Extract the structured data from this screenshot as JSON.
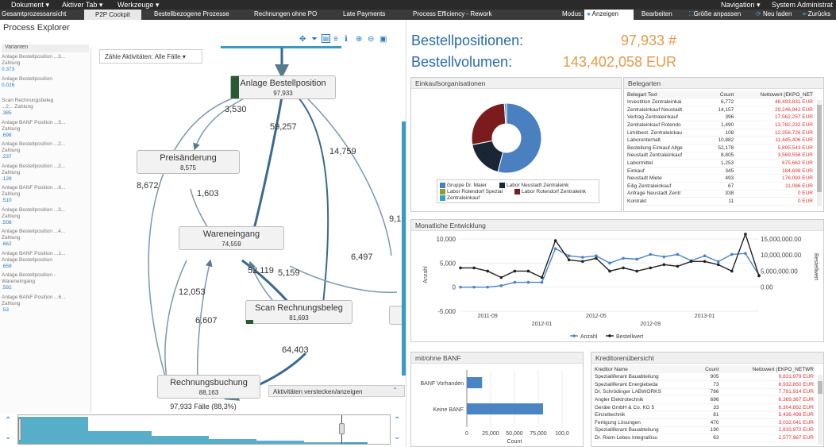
{
  "menu": {
    "dokument": "Dokument ▾",
    "aktiver_tab": "Aktiver Tab ▾",
    "werkzeuge": "Werkzeuge ▾",
    "navigation": "Navigation ▾",
    "user": "System Administrat"
  },
  "tabs": [
    "Gesamtprozessansicht",
    "P2P Cockpit",
    "Bestellbezogene Prozesse",
    "Rechnungen ohne PO",
    "Late Payments",
    "Process Efficiency - Rework"
  ],
  "toolbar": {
    "modus": "Modus:",
    "anzeigen": "Anzeigen",
    "bearbeiten": "Bearbeiten",
    "groesse": "Größe anpassen",
    "neu_laden": "Neu laden",
    "zurueck": "Zurücks"
  },
  "process_explorer": {
    "title": "Process Explorer",
    "variants_header": "Varianten",
    "variants": [
      {
        "name": "Anlage Bestellposition ...3...",
        "sub": "Zahlung",
        "val": "0.373"
      },
      {
        "name": "Anlage Bestellposition",
        "sub": "",
        "val": "0.026"
      },
      {
        "name": "Scan Rechnungsbeleg",
        "sub": "...2... Zahlung",
        "val": ".385"
      },
      {
        "name": "Anlage BANF Position ...5...",
        "sub": "Zahlung",
        "val": ".698"
      },
      {
        "name": "Anlage Bestellposition ...2...",
        "sub": "Zahlung",
        "val": ".237"
      },
      {
        "name": "Anlage Bestellposition ...2...",
        "sub": "Zahlung",
        "val": ".128"
      },
      {
        "name": "Anlage BANF Position ...6...",
        "sub": "Zahlung",
        "val": ".510"
      },
      {
        "name": "Anlage Bestellposition ...3...",
        "sub": "Zahlung",
        "val": ".508"
      },
      {
        "name": "Anlage Bestellposition ...4...",
        "sub": "Zahlung",
        "val": ".662"
      },
      {
        "name": "Anlage BANF Position ...1...",
        "sub": "Anlage Bestellposition",
        "val": ".659"
      },
      {
        "name": "Anlage Bestellposition -",
        "sub": "Wareneingang",
        "val": ".592"
      },
      {
        "name": "Anlage BANF Position ...6...",
        "sub": "Zahlung",
        "val": ".53"
      }
    ],
    "count_dropdown": "Zähle Aktivitäten: Alle Fälle ▾",
    "nodes": [
      {
        "id": "anlage",
        "label": "Anlage Bestellposition",
        "count": "97,933"
      },
      {
        "id": "preis",
        "label": "Preisänderung",
        "count": "8,575"
      },
      {
        "id": "wareneingang",
        "label": "Wareneingang",
        "count": "74,559"
      },
      {
        "id": "scan",
        "label": "Scan Rechnungsbeleg",
        "count": "81,693"
      },
      {
        "id": "rechnung",
        "label": "Rechnungsbuchung",
        "count": "88,163"
      }
    ],
    "edges": [
      "3,530",
      "59,257",
      "14,759",
      "8,672",
      "1,603",
      "9,1",
      "52,119",
      "5,159",
      "6,497",
      "12,053",
      "6,607",
      "64,403"
    ],
    "hide_label": "Aktivitäten verstecken/anzeigen",
    "case_count": "97,933 Fälle (88,3%)"
  },
  "kpis": [
    {
      "label": "Bestellpositionen:",
      "value": "97,933 #"
    },
    {
      "label": "Bestellvolumen:",
      "value": "143,402,058 EUR"
    }
  ],
  "einkauf": {
    "title": "Einkaufsorganisationen",
    "legend": [
      {
        "name": "Gruppe Dr. Maier",
        "color": "#4a7fc0"
      },
      {
        "name": "Labor Neustadt Zentraleink",
        "color": "#1a2636"
      },
      {
        "name": "Labor Rotendorf Spezial",
        "color": "#8aa030"
      },
      {
        "name": "Labor Rotendorf Zentraleink",
        "color": "#7a1c1e"
      },
      {
        "name": "Zentraleinkauf",
        "color": "#3aa0c0"
      }
    ],
    "slices": [
      {
        "name": "Gruppe Dr. Maier",
        "value": 54,
        "color": "#4a7fc0"
      },
      {
        "name": "Labor Neustadt Zentraleink",
        "value": 18,
        "color": "#1a2636"
      },
      {
        "name": "Labor Rotendorf Zentraleink",
        "value": 27,
        "color": "#7a1c1e"
      },
      {
        "name": "Zentraleinkauf",
        "value": 1,
        "color": "#3aa0c0"
      }
    ]
  },
  "belegarten": {
    "title": "Belegarten",
    "columns": [
      "Belegart Text",
      "Count",
      "Nettowert (EKPO_NET"
    ],
    "rows": [
      [
        "Investition Zentraleinkai",
        "6,772",
        "48,493,831 EUR"
      ],
      [
        "Zentraleinkauf Neustadt",
        "14,157",
        "29,246,942 EUR"
      ],
      [
        "Vertrag Zentraleinkauf",
        "396",
        "17,562,257 EUR"
      ],
      [
        "Zentraleinkauf Rotendo",
        "1,490",
        "13,782,232 EUR"
      ],
      [
        "Limitbest. Zentraleinkau",
        "108",
        "12,356,726 EUR"
      ],
      [
        "Laborunterhalt",
        "10,882",
        "11,445,406 EUR"
      ],
      [
        "Bestellung Einkauf Allge",
        "52,178",
        "5,895,543 EUR"
      ],
      [
        "Neustadt Zentraleinkauf",
        "8,805",
        "3,569,556 EUR"
      ],
      [
        "Labormittel",
        "1,253",
        "675,662 EUR"
      ],
      [
        "Einkauf",
        "345",
        "184,698 EUR"
      ],
      [
        "Neustadt Miete",
        "493",
        "176,093 EUR"
      ],
      [
        "Eilig Zentraleinkauf",
        "67",
        "11,086 EUR"
      ],
      [
        "Anfrage Neustadt Zentr",
        "338",
        "0 EUR"
      ],
      [
        "Kontrakt",
        "11",
        "0 EUR"
      ]
    ]
  },
  "monatlich": {
    "title": "Monatliche Entwicklung",
    "ylabel_left": "Anzahl",
    "ylabel_right": "Bestellwert",
    "left_ticks": [
      "10,000",
      "5,000",
      "0",
      "-5,000"
    ],
    "right_ticks": [
      "15,000,000.00",
      "10,000,000.00",
      "5,000,000.00",
      "0.00"
    ],
    "x_ticks_top": [
      "2011-09",
      "2012-05",
      "2013-01"
    ],
    "x_ticks_bottom": [
      "2012-01",
      "2012-09"
    ],
    "legend": [
      "Anzahl",
      "Bestellwert"
    ]
  },
  "chart_data": [
    {
      "type": "line",
      "title": "Monatliche Entwicklung",
      "xlabel": "",
      "ylabel": "Anzahl",
      "ylim": [
        -5000,
        10000
      ],
      "y2label": "Bestellwert",
      "y2lim": [
        0,
        15000000
      ],
      "x": [
        "2011-07",
        "2011-08",
        "2011-09",
        "2011-10",
        "2011-11",
        "2011-12",
        "2012-01",
        "2012-02",
        "2012-03",
        "2012-04",
        "2012-05",
        "2012-06",
        "2012-07",
        "2012-08",
        "2012-09",
        "2012-10",
        "2012-11",
        "2012-12",
        "2013-01",
        "2013-02",
        "2013-03",
        "2013-04",
        "2013-05"
      ],
      "series": [
        {
          "name": "Anzahl",
          "axis": "left",
          "color": "#4a84c4",
          "values": [
            0,
            0,
            0,
            300,
            1000,
            1000,
            1000,
            8000,
            6500,
            6200,
            6500,
            5000,
            6000,
            5800,
            6800,
            6300,
            6800,
            5500,
            6500,
            5300,
            6800,
            7000,
            2500
          ]
        },
        {
          "name": "Bestellwert",
          "axis": "right",
          "color": "#222",
          "values": [
            6000000,
            6000000,
            5000000,
            3000000,
            5000000,
            5000000,
            3000000,
            14500000,
            8500000,
            8000000,
            9000000,
            5000000,
            6000000,
            5000000,
            6000000,
            7000000,
            6500000,
            8000000,
            8000000,
            7000000,
            5000000,
            16500000,
            3500000
          ]
        }
      ]
    },
    {
      "type": "bar",
      "title": "mit/ohne BANF",
      "orientation": "horizontal",
      "categories": [
        "BANF Vorhanden",
        "Keine BANF"
      ],
      "values": [
        16000,
        80000
      ],
      "xlabel": "Count",
      "xlim": [
        0,
        100000
      ],
      "x_ticks": [
        "0",
        "25,000",
        "50,000",
        "75,000",
        "100,0"
      ]
    }
  ],
  "banf": {
    "title": "mit/ohne BANF"
  },
  "kreditoren": {
    "title": "Kreditorenübersicht",
    "columns": [
      "Kreditor Name",
      "Count",
      "Nettowert (EKPO_NETWR"
    ],
    "rows": [
      [
        "Spezialliferant Bauabteilung",
        "905",
        "9,831,979 EUR"
      ],
      [
        "Spezialliferant Energiebeda",
        "73",
        "8,932,850 EUR"
      ],
      [
        "Dr. Schrödinger LABWORKS",
        "786",
        "7,791,914 EUR"
      ],
      [
        "Angler Elektrotechnik",
        "696",
        "6,369,367 EUR"
      ],
      [
        "Geräte GmbH & Co. KG 5",
        "33",
        "6,304,892 EUR"
      ],
      [
        "Einzeltechnik",
        "81",
        "5,436,498 EUR"
      ],
      [
        "Fertigung Lösungen",
        "470",
        "3,032,041 EUR"
      ],
      [
        "Spezialliferant Bauabteilung",
        "190",
        "2,833,972 EUR"
      ],
      [
        "Dr. Riem-Lebes Integralösu",
        "63",
        "2,577,967 EUR"
      ]
    ]
  }
}
